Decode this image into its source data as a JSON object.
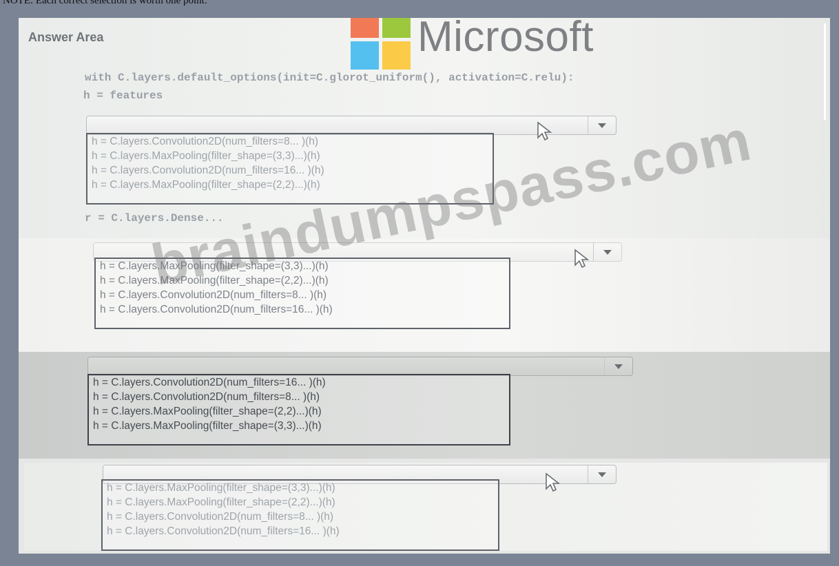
{
  "page": {
    "note": "NOTE: Each correct selection is worth one point."
  },
  "answer_area": {
    "title": "Answer Area",
    "code": {
      "with_line": "with C.layers.default_options(init=C.glorot_uniform(), activation=C.relu):",
      "h_line": "h = features",
      "r_line": "r = C.layers.Dense..."
    }
  },
  "logo": {
    "text": "Microsoft",
    "colors": [
      "#f25022",
      "#7fba00",
      "#00a4ef",
      "#ffb900"
    ]
  },
  "watermark": {
    "text": "braindumpspass.com"
  },
  "dropdowns": [
    {
      "options": [
        "h = C.layers.Convolution2D(num_filters=8... )(h)",
        "h = C.layers.MaxPooling(filter_shape=(3,3)...)(h)",
        "h = C.layers.Convolution2D(num_filters=16... )(h)",
        "h = C.layers.MaxPooling(filter_shape=(2,2)...)(h)"
      ]
    },
    {
      "options": [
        "h = C.layers.MaxPooling(filter_shape=(3,3)...)(h)",
        "h = C.layers.MaxPooling(filter_shape=(2,2)...)(h)",
        "h = C.layers.Convolution2D(num_filters=8... )(h)",
        "h = C.layers.Convolution2D(num_filters=16... )(h)"
      ]
    },
    {
      "options": [
        "h = C.layers.Convolution2D(num_filters=16... )(h)",
        "h = C.layers.Convolution2D(num_filters=8... )(h)",
        "h = C.layers.MaxPooling(filter_shape=(2,2)...)(h)",
        "h = C.layers.MaxPooling(filter_shape=(3,3)...)(h)"
      ]
    },
    {
      "options": [
        "h = C.layers.MaxPooling(filter_shape=(3,3)...)(h)",
        "h = C.layers.MaxPooling(filter_shape=(2,2)...)(h)",
        "h = C.layers.Convolution2D(num_filters=8... )(h)",
        "h = C.layers.Convolution2D(num_filters=16... )(h)"
      ]
    }
  ]
}
